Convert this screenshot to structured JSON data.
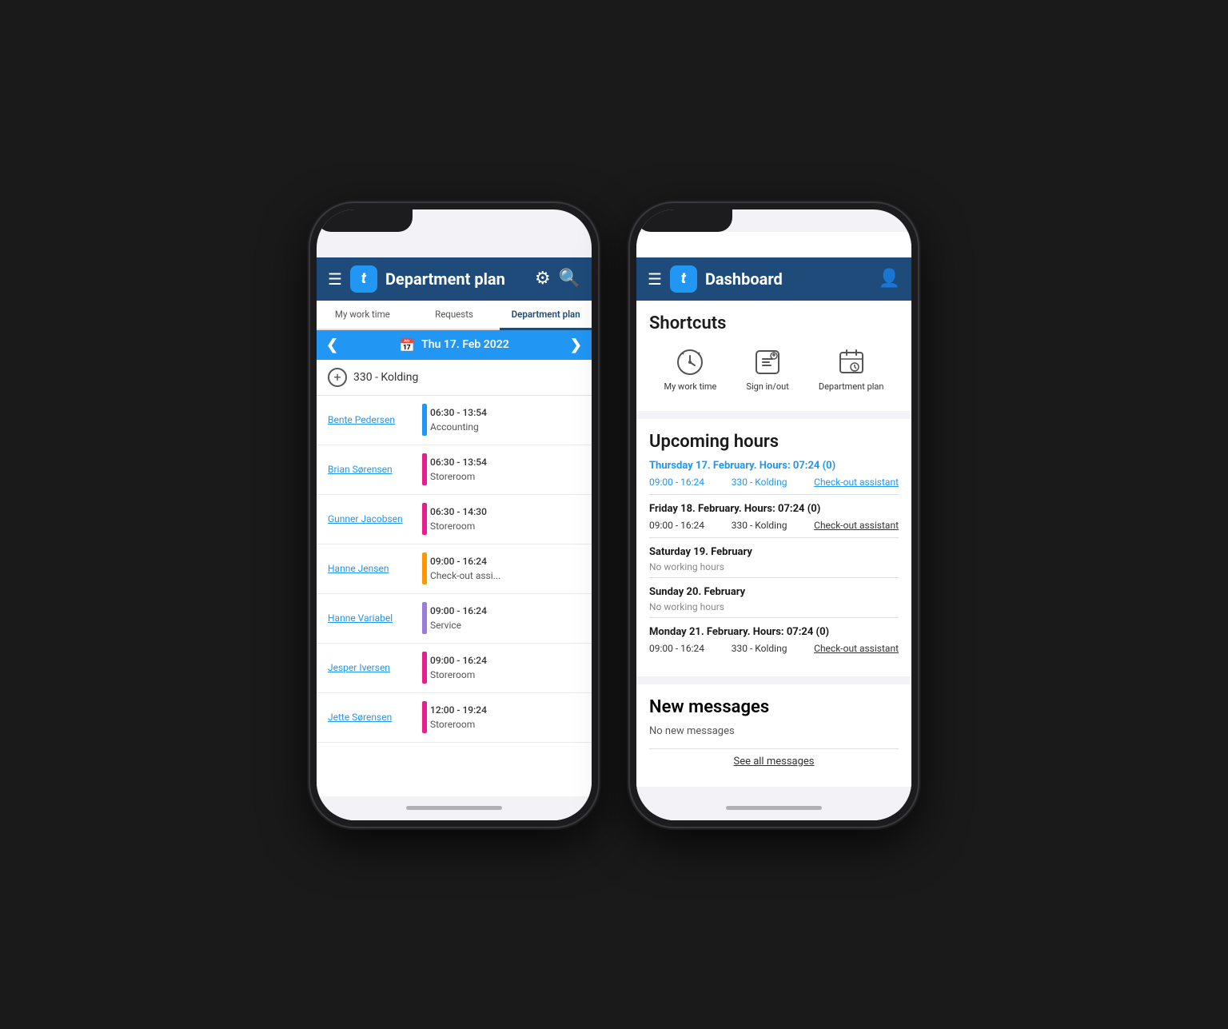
{
  "phone1": {
    "header": {
      "title": "Department plan",
      "logo": "t"
    },
    "tabs": [
      {
        "label": "My work time",
        "active": false
      },
      {
        "label": "Requests",
        "active": false
      },
      {
        "label": "Department plan",
        "active": true
      }
    ],
    "dateNav": {
      "date": "Thu 17. Feb 2022"
    },
    "location": "330 - Kolding",
    "employees": [
      {
        "name": "Bente Pedersen",
        "time": "06:30 - 13:54",
        "dept": "Accounting",
        "color": "#2196f3"
      },
      {
        "name": "Brian Sørensen",
        "time": "06:30 - 13:54",
        "dept": "Storeroom",
        "color": "#e91e8c"
      },
      {
        "name": "Gunner Jacobsen",
        "time": "06:30 - 14:30",
        "dept": "Storeroom",
        "color": "#e91e8c"
      },
      {
        "name": "Hanne Jensen",
        "time": "09:00 - 16:24",
        "dept": "Check-out assi...",
        "color": "#ff9800"
      },
      {
        "name": "Hanne Variabel",
        "time": "09:00 - 16:24",
        "dept": "Service",
        "color": "#9c7cdb"
      },
      {
        "name": "Jesper Iversen",
        "time": "09:00 - 16:24",
        "dept": "Storeroom",
        "color": "#e91e8c"
      },
      {
        "name": "Jette Sørensen",
        "time": "12:00 - 19:24",
        "dept": "Storeroom",
        "color": "#e91e8c"
      }
    ]
  },
  "phone2": {
    "header": {
      "title": "Dashboard",
      "logo": "t"
    },
    "shortcuts": {
      "title": "Shortcuts",
      "items": [
        {
          "label": "My work time",
          "icon": "clock"
        },
        {
          "label": "Sign in/out",
          "icon": "signin"
        },
        {
          "label": "Department plan",
          "icon": "calendar"
        }
      ]
    },
    "upcoming": {
      "title": "Upcoming hours",
      "days": [
        {
          "header": "Thursday 17. February. Hours: 07:24 (0)",
          "highlighted": true,
          "rows": [
            {
              "time": "09:00 - 16:24",
              "location": "330 - Kolding",
              "action": "Check-out assistant",
              "highlighted": true
            }
          ]
        },
        {
          "header": "Friday 18. February. Hours: 07:24 (0)",
          "highlighted": false,
          "rows": [
            {
              "time": "09:00 - 16:24",
              "location": "330 - Kolding",
              "action": "Check-out assistant",
              "highlighted": false
            }
          ]
        },
        {
          "header": "Saturday 19. February",
          "highlighted": false,
          "rows": [],
          "noHours": "No working hours"
        },
        {
          "header": "Sunday 20. February",
          "highlighted": false,
          "rows": [],
          "noHours": "No working hours"
        },
        {
          "header": "Monday 21. February. Hours: 07:24 (0)",
          "highlighted": false,
          "rows": [
            {
              "time": "09:00 - 16:24",
              "location": "330 - Kolding",
              "action": "Check-out assistant",
              "highlighted": false
            }
          ]
        }
      ]
    },
    "messages": {
      "title": "New messages",
      "noMessages": "No new messages",
      "seeAll": "See all messages"
    }
  }
}
